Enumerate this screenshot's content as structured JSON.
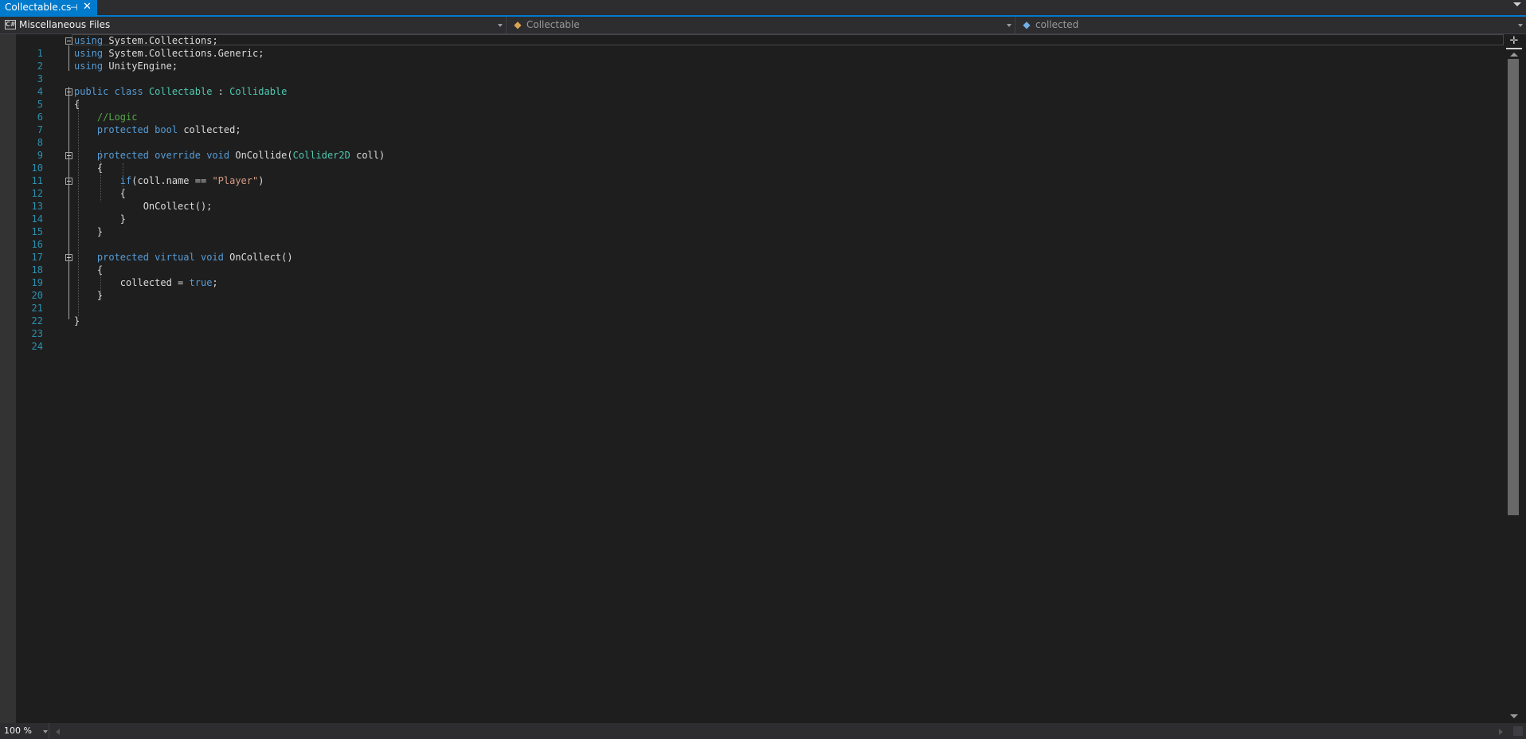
{
  "tab": {
    "title": "Collectable.cs",
    "pin_icon": "pin-icon",
    "close_icon": "close-icon"
  },
  "navbar": {
    "project": "Miscellaneous Files",
    "type": "Collectable",
    "member": "collected"
  },
  "editor": {
    "line_numbers": [
      "1",
      "2",
      "3",
      "4",
      "5",
      "6",
      "7",
      "8",
      "9",
      "10",
      "11",
      "12",
      "13",
      "14",
      "15",
      "16",
      "17",
      "18",
      "19",
      "20",
      "21",
      "22",
      "23",
      "24"
    ],
    "lines": [
      "using System.Collections;",
      "using System.Collections.Generic;",
      "using UnityEngine;",
      "",
      "public class Collectable : Collidable",
      "{",
      "    //Logic",
      "    protected bool collected;",
      "",
      "    protected override void OnCollide(Collider2D coll)",
      "    {",
      "        if(coll.name == \"Player\")",
      "        {",
      "            OnCollect();",
      "        }",
      "    }",
      "",
      "    protected virtual void OnCollect()",
      "    {",
      "        collected = true;",
      "    }",
      "",
      "}",
      ""
    ]
  },
  "statusbar": {
    "zoom": "100 %"
  },
  "colors": {
    "accent": "#007acc",
    "keyword": "#569cd6",
    "type": "#4ec9b0",
    "comment": "#57a64a",
    "string": "#d69d85",
    "line_number": "#2b91af",
    "background": "#1e1e1e"
  }
}
